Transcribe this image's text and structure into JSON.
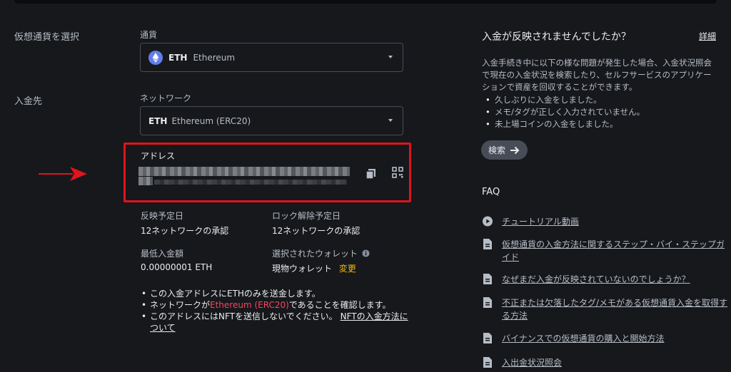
{
  "left": {
    "step_select_crypto": "仮想通貨を選択",
    "step_deposit_to": "入金先",
    "currency_label": "通貨",
    "currency_code": "ETH",
    "currency_name": "Ethereum",
    "network_label": "ネットワーク",
    "network_code": "ETH",
    "network_name": "Ethereum (ERC20)",
    "address_label": "アドレス",
    "expected_arrival_label": "反映予定日",
    "expected_arrival_value": "12ネットワークの承認",
    "expected_unlock_label": "ロック解除予定日",
    "expected_unlock_value": "12ネットワークの承認",
    "min_deposit_label": "最低入金額",
    "min_deposit_value": "0.00000001 ETH",
    "selected_wallet_label": "選択されたウォレット",
    "selected_wallet_value": "現物ウォレット",
    "change_label": "変更",
    "notes": {
      "note1": "この入金アドレスにETHのみを送金します。",
      "note2_pre": "ネットワークが",
      "note2_highlight": "Ethereum (ERC20)",
      "note2_post": "であることを確認します。",
      "note3_pre": "このアドレスにはNFTを送信しないでください。",
      "note3_link": "NFTの入金方法について"
    }
  },
  "right": {
    "title": "入金が反映されませんでしたか？",
    "details_link": "詳細",
    "body": "入金手続き中に以下の様な問題が発生した場合、入金状況照会で現在の入金状況を検索したり、セルフサービスのアプリケーションで資産を回収することができます。",
    "bullets": [
      "久しぶりに入金をしました。",
      "メモ/タグが正しく入力されていません。",
      "未上場コインの入金をしました。"
    ],
    "search_button": "検索",
    "faq_title": "FAQ",
    "faq_items": [
      {
        "icon": "play-circle-icon",
        "text": "チュートリアル動画"
      },
      {
        "icon": "document-icon",
        "text": "仮想通貨の入金方法に関するステップ・バイ・ステップガイド"
      },
      {
        "icon": "document-icon",
        "text": "なぜまだ入金が反映されていないのでしょうか？"
      },
      {
        "icon": "document-icon",
        "text": "不正または欠落したタグ/メモがある仮想通貨入金を取得する方法"
      },
      {
        "icon": "document-icon",
        "text": "バイナンスでの仮想通貨の購入と開始方法"
      },
      {
        "icon": "document-icon",
        "text": "入出金状況照会"
      }
    ]
  },
  "colors": {
    "background": "#16181c",
    "highlight_box": "#e0141c",
    "arrow": "#e0141c",
    "accent_yellow": "#f0b90b",
    "accent_red": "#f6465d"
  }
}
